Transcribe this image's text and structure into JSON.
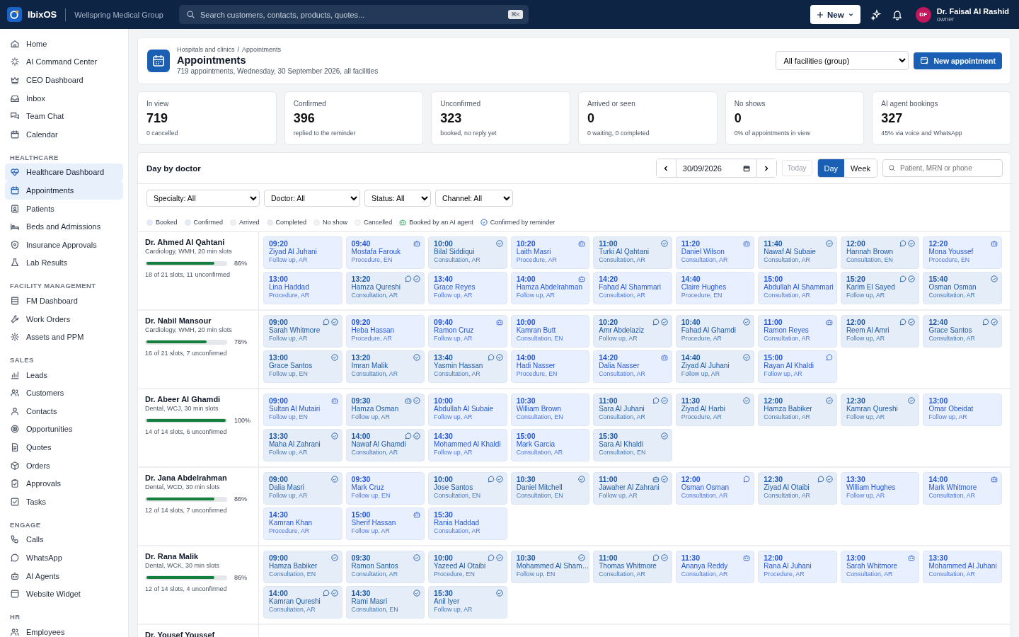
{
  "topbar": {
    "app_name": "IbixOS",
    "org": "Wellspring Medical Group",
    "search": {
      "placeholder": "Search customers, contacts, products, quotes...",
      "shortcut": "⌘K"
    },
    "new_button": "New",
    "user": {
      "initials": "DF",
      "name": "Dr. Faisal Al Rashid",
      "role": "owner"
    }
  },
  "sidebar": {
    "sections": [
      {
        "items": [
          {
            "label": "Home",
            "selected": false
          },
          {
            "label": "AI Command Center",
            "selected": false
          },
          {
            "label": "CEO Dashboard",
            "selected": false
          },
          {
            "label": "Inbox",
            "selected": false
          },
          {
            "label": "Team Chat",
            "selected": false
          },
          {
            "label": "Calendar",
            "selected": false
          }
        ]
      },
      {
        "heading": "HEALTHCARE",
        "items": [
          {
            "label": "Healthcare Dashboard",
            "selected": true
          },
          {
            "label": "Appointments",
            "selected": true
          },
          {
            "label": "Patients",
            "selected": false
          },
          {
            "label": "Beds and Admissions",
            "selected": false
          },
          {
            "label": "Insurance Approvals",
            "selected": false
          },
          {
            "label": "Lab Results",
            "selected": false
          }
        ]
      },
      {
        "heading": "FACILITY MANAGEMENT",
        "items": [
          {
            "label": "FM Dashboard",
            "selected": false
          },
          {
            "label": "Work Orders",
            "selected": false
          },
          {
            "label": "Assets and PPM",
            "selected": false
          }
        ]
      },
      {
        "heading": "SALES",
        "items": [
          {
            "label": "Leads",
            "selected": false
          },
          {
            "label": "Customers",
            "selected": false
          },
          {
            "label": "Contacts",
            "selected": false
          },
          {
            "label": "Opportunities",
            "selected": false
          },
          {
            "label": "Quotes",
            "selected": false
          },
          {
            "label": "Orders",
            "selected": false
          },
          {
            "label": "Approvals",
            "selected": false
          },
          {
            "label": "Tasks",
            "selected": false
          }
        ]
      },
      {
        "heading": "ENGAGE",
        "items": [
          {
            "label": "Calls",
            "selected": false
          },
          {
            "label": "WhatsApp",
            "selected": false
          },
          {
            "label": "AI Agents",
            "selected": false
          },
          {
            "label": "Website Widget",
            "selected": false
          }
        ]
      },
      {
        "heading": "HR",
        "items": [
          {
            "label": "Employees",
            "selected": false
          }
        ]
      }
    ]
  },
  "header": {
    "breadcrumb": [
      "Hospitals and clinics",
      "Appointments"
    ],
    "separator": "/",
    "title": "Appointments",
    "subtitle": "719 appointments, Wednesday, 30 September 2026, all facilities",
    "facility": "All facilities (group)",
    "new_button": "New appointment"
  },
  "kpis": [
    {
      "label": "In view",
      "value": "719",
      "note": "0 cancelled"
    },
    {
      "label": "Confirmed",
      "value": "396",
      "note": "replied to the reminder"
    },
    {
      "label": "Unconfirmed",
      "value": "323",
      "note": "booked, no reply yet"
    },
    {
      "label": "Arrived or seen",
      "value": "0",
      "note": "0 waiting, 0 completed"
    },
    {
      "label": "No shows",
      "value": "0",
      "note": "0% of appointments in view"
    },
    {
      "label": "AI agent bookings",
      "value": "327",
      "note": "45% via voice and WhatsApp"
    }
  ],
  "board": {
    "title": "Day by doctor",
    "date": "30/09/2026",
    "today": "Today",
    "views": [
      {
        "label": "Day",
        "selected": true
      },
      {
        "label": "Week",
        "selected": false
      }
    ],
    "search_placeholder": "Patient, MRN or phone",
    "filters": [
      "Specialty: All",
      "Doctor: All",
      "Status: All",
      "Channel: All"
    ],
    "legend": [
      {
        "kind": "dot",
        "label": "Booked",
        "color": "#e2eafc"
      },
      {
        "kind": "dot",
        "label": "Confirmed",
        "color": "#e1eaf7"
      },
      {
        "kind": "dot",
        "label": "Arrived",
        "color": "#eef0f3"
      },
      {
        "kind": "dot",
        "label": "Completed",
        "color": "#e9ebef"
      },
      {
        "kind": "dot",
        "label": "No show",
        "color": "#f1f2f4"
      },
      {
        "kind": "dot",
        "label": "Cancelled",
        "color": "#f5f6f8"
      },
      {
        "kind": "ai",
        "label": "Booked by an AI agent"
      },
      {
        "kind": "reminder",
        "label": "Confirmed by reminder"
      }
    ],
    "doctors": [
      {
        "name": "Dr. Ahmed Al Qahtani",
        "meta": "Cardiology, WMH, 20 min slots",
        "level": 0.86,
        "percent": "86%",
        "summary": "18 of 21 slots, 11 unconfirmed",
        "slots": [
          {
            "time": "09:20",
            "patient": "Ziyad Al Juhani",
            "detail": "Follow up, AR",
            "confirmed": false,
            "ai": false,
            "whatsapp": false
          },
          {
            "time": "09:40",
            "patient": "Mostafa Farouk",
            "detail": "Procedure, EN",
            "confirmed": false,
            "ai": true,
            "whatsapp": false
          },
          {
            "time": "10:00",
            "patient": "Bilal Siddiqui",
            "detail": "Consultation, AR",
            "confirmed": true,
            "ai": false,
            "whatsapp": false
          },
          {
            "time": "10:20",
            "patient": "Laith Masri",
            "detail": "Procedure, AR",
            "confirmed": false,
            "ai": true,
            "whatsapp": false
          },
          {
            "time": "11:00",
            "patient": "Turki Al Qahtani",
            "detail": "Consultation, AR",
            "confirmed": true,
            "ai": false,
            "whatsapp": false
          },
          {
            "time": "11:20",
            "patient": "Daniel Wilson",
            "detail": "Consultation, AR",
            "confirmed": false,
            "ai": true,
            "whatsapp": false
          },
          {
            "time": "11:40",
            "patient": "Nawaf Al Subaie",
            "detail": "Consultation, AR",
            "confirmed": true,
            "ai": false,
            "whatsapp": false
          },
          {
            "time": "12:00",
            "patient": "Hannah Brown",
            "detail": "Consultation, EN",
            "confirmed": true,
            "ai": false,
            "whatsapp": true
          },
          {
            "time": "12:20",
            "patient": "Mona Youssef",
            "detail": "Procedure, EN",
            "confirmed": false,
            "ai": true,
            "whatsapp": false
          },
          {
            "time": "13:00",
            "patient": "Lina Haddad",
            "detail": "Procedure, AR",
            "confirmed": false,
            "ai": false,
            "whatsapp": false
          },
          {
            "time": "13:20",
            "patient": "Hamza Qureshi",
            "detail": "Consultation, AR",
            "confirmed": true,
            "ai": false,
            "whatsapp": true
          },
          {
            "time": "13:40",
            "patient": "Grace Reyes",
            "detail": "Follow up, AR",
            "confirmed": false,
            "ai": false,
            "whatsapp": false
          },
          {
            "time": "14:00",
            "patient": "Hamza Abdelrahman",
            "detail": "Follow up, AR",
            "confirmed": false,
            "ai": true,
            "whatsapp": false
          },
          {
            "time": "14:20",
            "patient": "Fahad Al Shammari",
            "detail": "Consultation, AR",
            "confirmed": false,
            "ai": false,
            "whatsapp": false
          },
          {
            "time": "14:40",
            "patient": "Claire Hughes",
            "detail": "Procedure, EN",
            "confirmed": false,
            "ai": false,
            "whatsapp": false
          },
          {
            "time": "15:00",
            "patient": "Abdullah Al Shammari",
            "detail": "Consultation, AR",
            "confirmed": false,
            "ai": false,
            "whatsapp": false
          },
          {
            "time": "15:20",
            "patient": "Karim El Sayed",
            "detail": "Follow up, AR",
            "confirmed": true,
            "ai": false,
            "whatsapp": true
          },
          {
            "time": "15:40",
            "patient": "Osman Osman",
            "detail": "Consultation, AR",
            "confirmed": true,
            "ai": false,
            "whatsapp": false
          }
        ]
      },
      {
        "name": "Dr. Nabil Mansour",
        "meta": "Cardiology, WMH, 20 min slots",
        "level": 0.76,
        "percent": "76%",
        "summary": "16 of 21 slots, 7 unconfirmed",
        "slots": [
          {
            "time": "09:00",
            "patient": "Sarah Whitmore",
            "detail": "Follow up, AR",
            "confirmed": true,
            "ai": false,
            "whatsapp": true
          },
          {
            "time": "09:20",
            "patient": "Heba Hassan",
            "detail": "Procedure, AR",
            "confirmed": false,
            "ai": false,
            "whatsapp": false
          },
          {
            "time": "09:40",
            "patient": "Ramon Cruz",
            "detail": "Follow up, AR",
            "confirmed": false,
            "ai": true,
            "whatsapp": false
          },
          {
            "time": "10:00",
            "patient": "Kamran Butt",
            "detail": "Consultation, EN",
            "confirmed": false,
            "ai": false,
            "whatsapp": false
          },
          {
            "time": "10:20",
            "patient": "Amr Abdelaziz",
            "detail": "Follow up, AR",
            "confirmed": true,
            "ai": false,
            "whatsapp": true
          },
          {
            "time": "10:40",
            "patient": "Fahad Al Ghamdi",
            "detail": "Procedure, AR",
            "confirmed": true,
            "ai": false,
            "whatsapp": false
          },
          {
            "time": "11:00",
            "patient": "Ramon Reyes",
            "detail": "Consultation, AR",
            "confirmed": false,
            "ai": true,
            "whatsapp": false
          },
          {
            "time": "12:00",
            "patient": "Reem Al Amri",
            "detail": "Follow up, AR",
            "confirmed": true,
            "ai": false,
            "whatsapp": true
          },
          {
            "time": "12:40",
            "patient": "Grace Santos",
            "detail": "Consultation, AR",
            "confirmed": true,
            "ai": false,
            "whatsapp": true
          },
          {
            "time": "13:00",
            "patient": "Grace Santos",
            "detail": "Follow up, EN",
            "confirmed": true,
            "ai": false,
            "whatsapp": false
          },
          {
            "time": "13:20",
            "patient": "Imran Malik",
            "detail": "Consultation, AR",
            "confirmed": true,
            "ai": false,
            "whatsapp": false
          },
          {
            "time": "13:40",
            "patient": "Yasmin Hassan",
            "detail": "Consultation, AR",
            "confirmed": true,
            "ai": false,
            "whatsapp": true
          },
          {
            "time": "14:00",
            "patient": "Hadi Nasser",
            "detail": "Procedure, EN",
            "confirmed": false,
            "ai": false,
            "whatsapp": false
          },
          {
            "time": "14:20",
            "patient": "Dalia Nasser",
            "detail": "Consultation, AR",
            "confirmed": false,
            "ai": true,
            "whatsapp": false
          },
          {
            "time": "14:40",
            "patient": "Ziyad Al Juhani",
            "detail": "Follow up, AR",
            "confirmed": true,
            "ai": false,
            "whatsapp": false
          },
          {
            "time": "15:00",
            "patient": "Rayan Al Khaldi",
            "detail": "Follow up, AR",
            "confirmed": false,
            "ai": false,
            "whatsapp": true
          }
        ]
      },
      {
        "name": "Dr. Abeer Al Ghamdi",
        "meta": "Dental, WCJ, 30 min slots",
        "level": 1.0,
        "percent": "100%",
        "summary": "14 of 14 slots, 6 unconfirmed",
        "slots": [
          {
            "time": "09:00",
            "patient": "Sultan Al Mutairi",
            "detail": "Follow up, EN",
            "confirmed": false,
            "ai": true,
            "whatsapp": false
          },
          {
            "time": "09:30",
            "patient": "Hamza Osman",
            "detail": "Follow up, AR",
            "confirmed": true,
            "ai": true,
            "whatsapp": false
          },
          {
            "time": "10:00",
            "patient": "Abdullah Al Subaie",
            "detail": "Follow up, AR",
            "confirmed": false,
            "ai": false,
            "whatsapp": false
          },
          {
            "time": "10:30",
            "patient": "William Brown",
            "detail": "Consultation, EN",
            "confirmed": false,
            "ai": false,
            "whatsapp": false
          },
          {
            "time": "11:00",
            "patient": "Sara Al Juhani",
            "detail": "Consultation, AR",
            "confirmed": true,
            "ai": false,
            "whatsapp": true
          },
          {
            "time": "11:30",
            "patient": "Ziyad Al Harbi",
            "detail": "Procedure, AR",
            "confirmed": true,
            "ai": false,
            "whatsapp": false
          },
          {
            "time": "12:00",
            "patient": "Hamza Babiker",
            "detail": "Consultation, AR",
            "confirmed": true,
            "ai": false,
            "whatsapp": false
          },
          {
            "time": "12:30",
            "patient": "Kamran Qureshi",
            "detail": "Follow up, AR",
            "confirmed": true,
            "ai": false,
            "whatsapp": false
          },
          {
            "time": "13:00",
            "patient": "Omar Obeidat",
            "detail": "Follow up, AR",
            "confirmed": false,
            "ai": false,
            "whatsapp": false
          },
          {
            "time": "13:30",
            "patient": "Maha Al Zahrani",
            "detail": "Follow up, AR",
            "confirmed": true,
            "ai": false,
            "whatsapp": false
          },
          {
            "time": "14:00",
            "patient": "Nawaf Al Ghamdi",
            "detail": "Consultation, AR",
            "confirmed": true,
            "ai": false,
            "whatsapp": true
          },
          {
            "time": "14:30",
            "patient": "Mohammed Al Khaldi",
            "detail": "Follow up, AR",
            "confirmed": false,
            "ai": false,
            "whatsapp": false
          },
          {
            "time": "15:00",
            "patient": "Mark Garcia",
            "detail": "Consultation, AR",
            "confirmed": false,
            "ai": false,
            "whatsapp": false
          },
          {
            "time": "15:30",
            "patient": "Sara Al Khaldi",
            "detail": "Consultation, EN",
            "confirmed": true,
            "ai": false,
            "whatsapp": false
          }
        ]
      },
      {
        "name": "Dr. Jana Abdelrahman",
        "meta": "Dental, WCD, 30 min slots",
        "level": 0.86,
        "percent": "86%",
        "summary": "12 of 14 slots, 7 unconfirmed",
        "slots": [
          {
            "time": "09:00",
            "patient": "Dalia Masri",
            "detail": "Follow up, AR",
            "confirmed": true,
            "ai": false,
            "whatsapp": false
          },
          {
            "time": "09:30",
            "patient": "Mark Cruz",
            "detail": "Follow up, EN",
            "confirmed": false,
            "ai": false,
            "whatsapp": false
          },
          {
            "time": "10:00",
            "patient": "Jose Santos",
            "detail": "Consultation, EN",
            "confirmed": true,
            "ai": false,
            "whatsapp": true
          },
          {
            "time": "10:30",
            "patient": "Daniel Mitchell",
            "detail": "Consultation, EN",
            "confirmed": true,
            "ai": false,
            "whatsapp": false
          },
          {
            "time": "11:00",
            "patient": "Jawaher Al Zahrani",
            "detail": "Follow up, AR",
            "confirmed": true,
            "ai": true,
            "whatsapp": false
          },
          {
            "time": "12:00",
            "patient": "Osman Osman",
            "detail": "Consultation, AR",
            "confirmed": false,
            "ai": false,
            "whatsapp": true
          },
          {
            "time": "12:30",
            "patient": "Ziyad Al Otaibi",
            "detail": "Consultation, AR",
            "confirmed": true,
            "ai": false,
            "whatsapp": true
          },
          {
            "time": "13:30",
            "patient": "William Hughes",
            "detail": "Follow up, AR",
            "confirmed": false,
            "ai": false,
            "whatsapp": false
          },
          {
            "time": "14:00",
            "patient": "Mark Whitmore",
            "detail": "Consultation, AR",
            "confirmed": false,
            "ai": true,
            "whatsapp": false
          },
          {
            "time": "14:30",
            "patient": "Kamran Khan",
            "detail": "Procedure, AR",
            "confirmed": false,
            "ai": false,
            "whatsapp": false
          },
          {
            "time": "15:00",
            "patient": "Sherif Hassan",
            "detail": "Follow up, AR",
            "confirmed": false,
            "ai": true,
            "whatsapp": false
          },
          {
            "time": "15:30",
            "patient": "Rania Haddad",
            "detail": "Consultation, AR",
            "confirmed": false,
            "ai": false,
            "whatsapp": false
          }
        ]
      },
      {
        "name": "Dr. Rana Malik",
        "meta": "Dental, WCK, 30 min slots",
        "level": 0.86,
        "percent": "86%",
        "summary": "12 of 14 slots, 4 unconfirmed",
        "slots": [
          {
            "time": "09:00",
            "patient": "Hamza Babiker",
            "detail": "Consultation, EN",
            "confirmed": true,
            "ai": false,
            "whatsapp": false
          },
          {
            "time": "09:30",
            "patient": "Ramon Santos",
            "detail": "Consultation, AR",
            "confirmed": true,
            "ai": false,
            "whatsapp": false
          },
          {
            "time": "10:00",
            "patient": "Yazeed Al Otaibi",
            "detail": "Procedure, EN",
            "confirmed": true,
            "ai": false,
            "whatsapp": true
          },
          {
            "time": "10:30",
            "patient": "Mohammed Al Sham…",
            "detail": "Follow up, EN",
            "confirmed": true,
            "ai": false,
            "whatsapp": false
          },
          {
            "time": "11:00",
            "patient": "Thomas Whitmore",
            "detail": "Consultation, AR",
            "confirmed": true,
            "ai": false,
            "whatsapp": true
          },
          {
            "time": "11:30",
            "patient": "Ananya Reddy",
            "detail": "Consultation, AR",
            "confirmed": false,
            "ai": true,
            "whatsapp": false
          },
          {
            "time": "12:00",
            "patient": "Rana Al Juhani",
            "detail": "Procedure, AR",
            "confirmed": false,
            "ai": false,
            "whatsapp": false
          },
          {
            "time": "13:00",
            "patient": "Sarah Whitmore",
            "detail": "Consultation, AR",
            "confirmed": false,
            "ai": true,
            "whatsapp": false
          },
          {
            "time": "13:30",
            "patient": "Mohammed Al Juhani",
            "detail": "Consultation, AR",
            "confirmed": false,
            "ai": false,
            "whatsapp": false
          },
          {
            "time": "14:00",
            "patient": "Kamran Qureshi",
            "detail": "Consultation, AR",
            "confirmed": true,
            "ai": false,
            "whatsapp": true
          },
          {
            "time": "14:30",
            "patient": "Rami Masri",
            "detail": "Consultation, EN",
            "confirmed": true,
            "ai": false,
            "whatsapp": false
          },
          {
            "time": "15:30",
            "patient": "Anil Iyer",
            "detail": "Follow up, AR",
            "confirmed": true,
            "ai": false,
            "whatsapp": false
          }
        ]
      },
      {
        "name": "Dr. Yousef Youssef"
      }
    ]
  }
}
